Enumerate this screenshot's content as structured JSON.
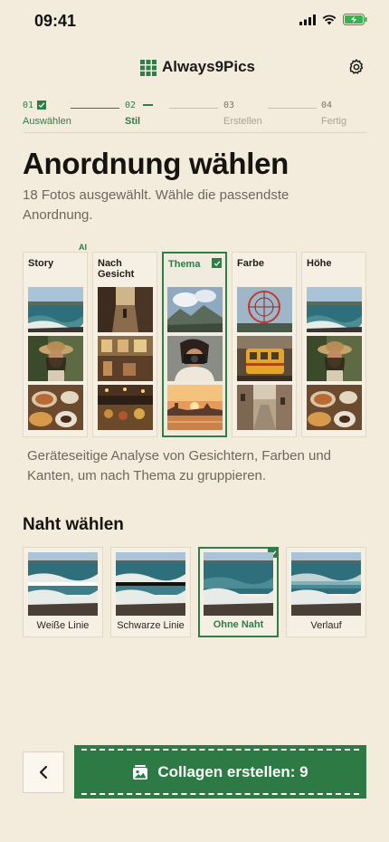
{
  "status": {
    "time": "09:41"
  },
  "app": {
    "title": "Always9Pics"
  },
  "stepper": {
    "steps": [
      {
        "num": "01",
        "label": "Auswählen",
        "state": "done"
      },
      {
        "num": "02",
        "label": "Stil",
        "state": "active"
      },
      {
        "num": "03",
        "label": "Erstellen",
        "state": "todo"
      },
      {
        "num": "04",
        "label": "Fertig",
        "state": "todo"
      }
    ]
  },
  "header": {
    "title": "Anordnung wählen",
    "subtitle": "18 Fotos ausgewählt. Wähle die passendste Anordnung."
  },
  "layouts": {
    "ai_badge": "AI",
    "options": [
      {
        "label": "Story",
        "thumbs": [
          "coast",
          "woman-hat",
          "breakfast"
        ]
      },
      {
        "label": "Nach Gesicht",
        "thumbs": [
          "alley",
          "cafe-street",
          "market-night"
        ]
      },
      {
        "label": "Thema",
        "thumbs": [
          "mountains",
          "photographer",
          "sunset-city"
        ],
        "selected": true
      },
      {
        "label": "Farbe",
        "thumbs": [
          "ferris-wheel",
          "tram",
          "street-old"
        ]
      },
      {
        "label": "Höhe",
        "thumbs": [
          "coast",
          "woman-hat",
          "breakfast"
        ]
      }
    ],
    "hint": "Geräteseitige Analyse von Gesichtern, Farben und Kanten, um nach Thema zu gruppieren."
  },
  "seam": {
    "title": "Naht wählen",
    "options": [
      {
        "label": "Weiße Linie"
      },
      {
        "label": "Schwarze Linie"
      },
      {
        "label": "Ohne Naht",
        "selected": true
      },
      {
        "label": "Verlauf"
      }
    ]
  },
  "actions": {
    "back_icon": "chevron-left-icon",
    "create_label": "Collagen erstellen: 9",
    "create_icon": "photos-icon"
  },
  "colors": {
    "accent": "#2f7d47",
    "background": "#f3ebdc"
  }
}
